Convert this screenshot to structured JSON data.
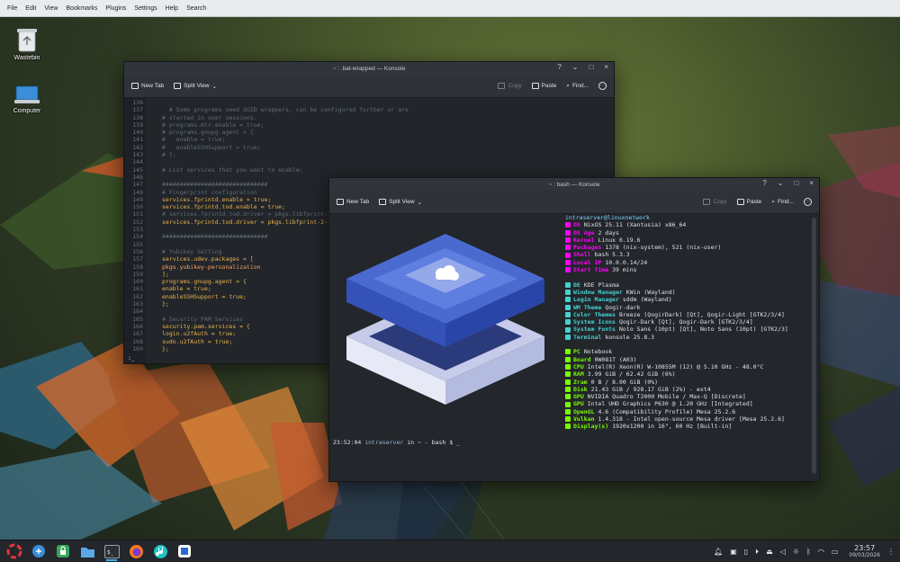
{
  "menubar": {
    "items": [
      "File",
      "Edit",
      "View",
      "Bookmarks",
      "Plugins",
      "Settings",
      "Help",
      "Search"
    ]
  },
  "desktop": {
    "icons": [
      {
        "label": "Wastebin",
        "icon": "recycle-bin-icon"
      },
      {
        "label": "Computer",
        "icon": "computer-icon"
      }
    ]
  },
  "window1": {
    "title": "~ : .bat-wrapped — Konsole",
    "toolbar": {
      "new_tab": "New Tab",
      "split_view": "Split View",
      "copy": "Copy",
      "paste": "Paste",
      "find": "Find..."
    },
    "line_numbers": [
      "136",
      "137",
      "138",
      "139",
      "140",
      "141",
      "142",
      "143",
      "144",
      "145",
      "146",
      "147",
      "148",
      "149",
      "150",
      "151",
      "152",
      "153",
      "154",
      "155",
      "156",
      "157",
      "158",
      "159",
      "160",
      "161",
      "162",
      "163",
      "164",
      "165",
      "166",
      "167",
      "168",
      "169"
    ],
    "code": [
      "",
      "  # Some programs need SUID wrappers, can be configured further or are",
      "# started in user sessions.",
      "# programs.mtr.enable = true;",
      "# programs.gnupg.agent = {",
      "#   enable = true;",
      "#   enableSSHSupport = true;",
      "# };",
      "",
      "# List services that you want to enable:",
      "",
      "##############################",
      "# Fingerprint configuration",
      "services.fprintd.enable = true;",
      "services.fprintd.tod.enable = true;",
      "# services.fprintd.tod.driver = pkgs.libfprint-2-tod1-goodix;",
      "services.fprintd.tod.driver = pkgs.libfprint-2-tod1-broadcom;",
      "",
      "##############################",
      "",
      "# Yubikey Setting",
      "services.udev.packages = [",
      "pkgs.yubikey-personalization",
      "];",
      "programs.gnupg.agent = {",
      "enable = true;",
      "enableSSHSupport = true;",
      "};",
      "",
      "# Security PAM Services",
      "security.pam.services = {",
      "login.u2fAuth = true;",
      "sudo.u2fAuth = true;",
      "};"
    ],
    "prompt": ":_"
  },
  "window2": {
    "title": "~ : bash — Konsole",
    "toolbar": {
      "new_tab": "New Tab",
      "split_view": "Split View",
      "copy": "Copy",
      "paste": "Paste",
      "find": "Find..."
    },
    "fastfetch": {
      "header": "intraserver@linuxnetwork",
      "os": [
        "OS",
        "NixOS 25.11 (Xantusia) x86_64"
      ],
      "system": [
        [
          "OS Age",
          "2 days"
        ],
        [
          "Kernel",
          "Linux 6.19.6"
        ],
        [
          "Packages",
          "1378 (nix-system), 521 (nix-user)"
        ],
        [
          "Shell",
          "bash 5.3.3"
        ],
        [
          "Local IP",
          "10.0.0.14/24"
        ],
        [
          "Start Time",
          "39 mins"
        ]
      ],
      "de": [
        "DE",
        "KDE Plasma"
      ],
      "desktop": [
        [
          "Window Manager",
          "KWin (Wayland)"
        ],
        [
          "Login Manager",
          "sddm (Wayland)"
        ],
        [
          "WM Theme",
          "Qogir-dark"
        ],
        [
          "Color Themes",
          "Breeze (QogirDark) [Qt], Qogir-Light [GTK2/3/4]"
        ],
        [
          "System Icons",
          "Qogir-Dark [Qt], Qogir-Dark [GTK2/3/4]"
        ],
        [
          "System Fonts",
          "Noto Sans (10pt) [Qt], Noto Sans (10pt) [GTK2/3]"
        ],
        [
          "Terminal",
          "konsole 25.8.3"
        ]
      ],
      "pc": [
        "PC",
        "Notebook"
      ],
      "hardware": [
        [
          "Board",
          "0W081T (A03)"
        ],
        [
          "CPU",
          "Intel(R) Xeon(R) W-10855M (12) @ 5.10 GHz - 48.0°C"
        ],
        [
          "RAM",
          "3.99 GiB / 62.42 GiB (6%)"
        ],
        [
          "Zram",
          "0 B / 8.00 GiB (0%)"
        ],
        [
          "Disk",
          "21.43 GiB / 928.17 GiB (2%) - ext4"
        ],
        [
          "GPU",
          "NVIDIA Quadro T2000 Mobile / Max-Q [Discrete]"
        ],
        [
          "GPU",
          "Intel UHD Graphics P630 @ 1.20 GHz [Integrated]"
        ],
        [
          "OpenGL",
          "4.6 (Compatibility Profile) Mesa 25.2.6"
        ],
        [
          "Vulkan",
          "1.4.318 - Intel open-source Mesa driver [Mesa 25.2.6]"
        ],
        [
          "Display(s)",
          "1920x1200 in 16\", 60 Hz [Built-in]"
        ]
      ]
    },
    "prompt": {
      "time": "23:52:04",
      "user": "intraserver",
      "in": "in",
      "cwd": "~",
      "shell": "bash",
      "sym": "$ _"
    }
  },
  "taskbar": {
    "clock_time": "23:57",
    "clock_date": "09/03/2026"
  },
  "colors": {
    "accent": "#3daee9",
    "key_magenta": "#ff00ff",
    "key_cyan": "#44d1d1",
    "key_green": "#7cfc00"
  }
}
